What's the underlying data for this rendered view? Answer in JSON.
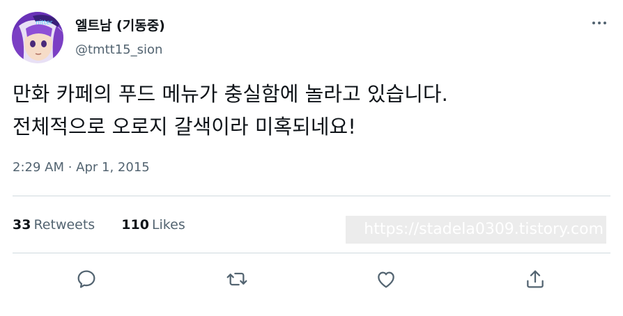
{
  "author": {
    "display_name": "엘트남 (기동중)",
    "handle": "@tmtt15_sion"
  },
  "tweet": {
    "lines": [
      "만화 카페의 푸드 메뉴가 충실함에 놀라고 있습니다.",
      "전체적으로 오로지 갈색이라 미혹되네요!"
    ],
    "timestamp": "2:29 AM · Apr 1, 2015"
  },
  "stats": {
    "retweets_count": "33",
    "retweets_label": "Retweets",
    "likes_count": "110",
    "likes_label": "Likes"
  },
  "watermark": "https://stadela0309.tistory.com",
  "icons": {
    "more": "more-horizontal-icon",
    "reply": "reply-icon",
    "retweet": "retweet-icon",
    "like": "heart-icon",
    "share": "share-icon"
  },
  "colors": {
    "text_primary": "#0f1419",
    "text_secondary": "#536471",
    "divider": "#cfd9de",
    "avatar_hair": "#7b3fc4"
  }
}
